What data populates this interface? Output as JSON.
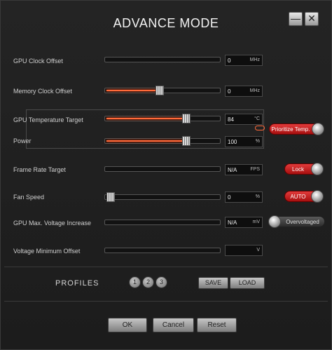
{
  "window": {
    "title": "ADVANCE MODE",
    "minimize_label": "—",
    "close_label": "✕"
  },
  "rows": {
    "gpu_clock": {
      "label": "GPU Clock Offset",
      "value": "0",
      "unit": "MHz",
      "level": 0
    },
    "memory_clock": {
      "label": "Memory Clock Offset",
      "value": "0",
      "unit": "MHz",
      "level": 0.5
    },
    "temp_target": {
      "label": "GPU Temperature Target",
      "value": "84",
      "unit": "°C",
      "level": 0.78
    },
    "power": {
      "label": "Power",
      "value": "100",
      "unit": "%",
      "level": 0.78
    },
    "frame_rate": {
      "label": "Frame Rate Target",
      "value": "N/A",
      "unit": "FPS"
    },
    "fan_speed": {
      "label": "Fan Speed",
      "value": "0",
      "unit": "%",
      "level": 0
    },
    "voltage_increase": {
      "label": "GPU Max. Voltage Increase",
      "value": "N/A",
      "unit": "mV"
    },
    "voltage_min": {
      "label": "Voltage Minimum Offset",
      "value": "",
      "unit": "V"
    }
  },
  "toggles": {
    "prioritize_temp": {
      "label": "Prioritize Temp.",
      "on": true
    },
    "lock": {
      "label": "Lock",
      "on": true
    },
    "auto": {
      "label": "AUTO",
      "on": true
    },
    "overvoltaged": {
      "label": "Overvoltaged",
      "on": false
    }
  },
  "profiles": {
    "label": "PROFILES",
    "numbers": [
      "1",
      "2",
      "3"
    ],
    "save_label": "SAVE",
    "load_label": "LOAD"
  },
  "footer": {
    "ok_label": "OK",
    "cancel_label": "Cancel",
    "reset_label": "Reset"
  },
  "colors": {
    "accent": "#ff6a3a",
    "toggle_on": "#c81b1b"
  },
  "icons": {
    "link": "link-icon"
  }
}
